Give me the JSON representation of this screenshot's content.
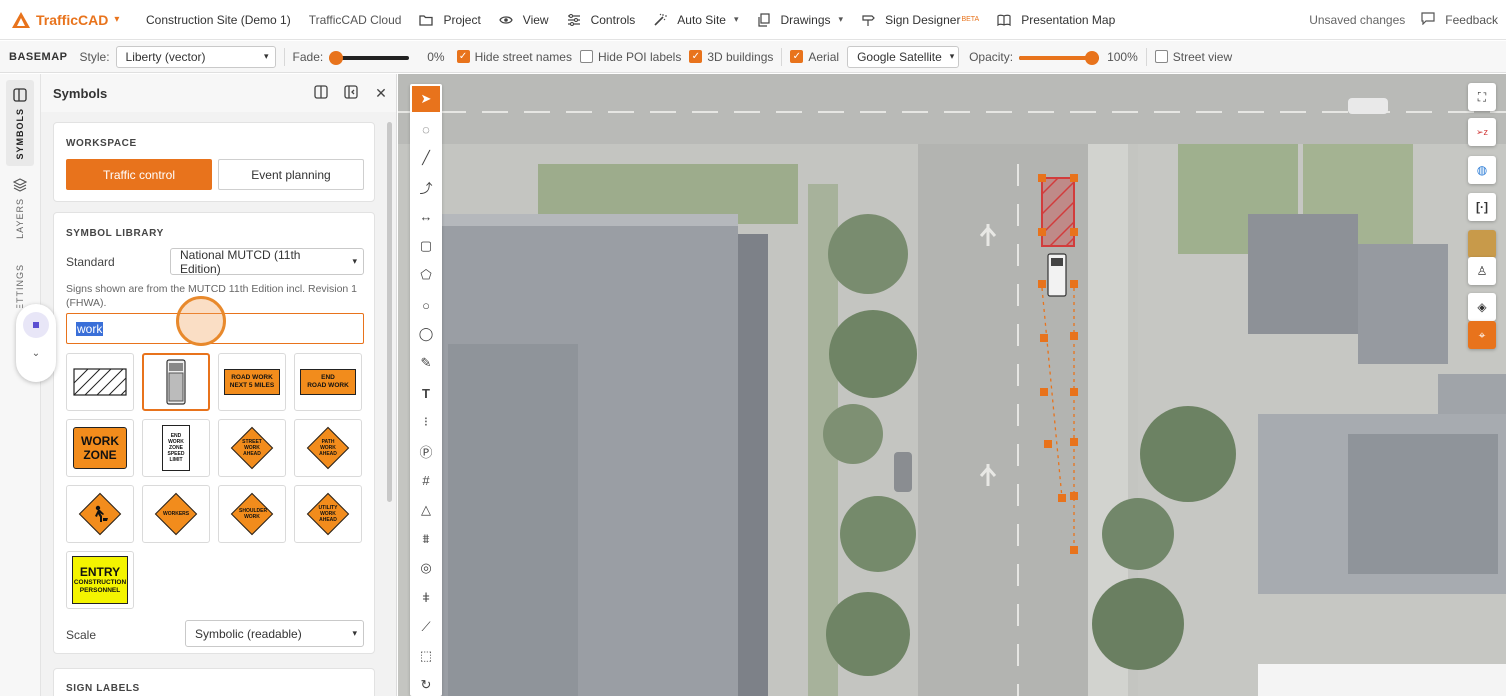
{
  "app": {
    "name": "TrafficCAD",
    "brand_color": "#e8731c"
  },
  "menu": {
    "project_name": "Construction Site (Demo 1)",
    "cloud": "TrafficCAD Cloud",
    "items": [
      {
        "label": "Project",
        "icon": "folder-icon"
      },
      {
        "label": "View",
        "icon": "eye-icon"
      },
      {
        "label": "Controls",
        "icon": "sliders-icon"
      },
      {
        "label": "Auto Site",
        "icon": "magic-wand-icon"
      },
      {
        "label": "Drawings",
        "icon": "drawings-icon"
      },
      {
        "label": "Sign Designer",
        "icon": "sign-icon",
        "badge": "BETA"
      },
      {
        "label": "Presentation Map",
        "icon": "book-icon"
      }
    ],
    "unsaved": "Unsaved changes",
    "feedback": "Feedback"
  },
  "basemap": {
    "label": "BASEMAP",
    "style_label": "Style:",
    "style_value": "Liberty (vector)",
    "fade_label": "Fade:",
    "fade_value": "0%",
    "fade_fraction": 0.0,
    "hide_street_names": {
      "label": "Hide street names",
      "checked": true
    },
    "hide_poi_labels": {
      "label": "Hide POI labels",
      "checked": false
    },
    "buildings_3d": {
      "label": "3D buildings",
      "checked": true
    },
    "aerial": {
      "label": "Aerial",
      "checked": true
    },
    "aerial_source": "Google Satellite",
    "opacity_label": "Opacity:",
    "opacity_value": "100%",
    "opacity_fraction": 1.0,
    "street_view": {
      "label": "Street view",
      "checked": false
    }
  },
  "rail": {
    "tabs": [
      "SYMBOLS",
      "LAYERS",
      "SETTINGS"
    ]
  },
  "panel": {
    "title": "Symbols",
    "workspace": {
      "heading": "WORKSPACE",
      "traffic_control": "Traffic control",
      "event_planning": "Event planning"
    },
    "library": {
      "heading": "SYMBOL LIBRARY",
      "standard_label": "Standard",
      "standard_value": "National MUTCD (11th Edition)",
      "note": "Signs shown are from the MUTCD 11th Edition incl. Revision 1 (FHWA).",
      "search_value": "work",
      "scale_label": "Scale",
      "scale_value": "Symbolic (readable)"
    },
    "signs": {
      "road_work_next": [
        "ROAD WORK",
        "NEXT 5 MILES"
      ],
      "end_road_work": [
        "END",
        "ROAD WORK"
      ],
      "work_zone": [
        "WORK",
        "ZONE"
      ],
      "end_work_zone_speed": [
        "END",
        "WORK",
        "ZONE",
        "SPEED",
        "LIMIT"
      ],
      "street_work_ahead": [
        "STREET",
        "WORK",
        "AHEAD"
      ],
      "path_work_ahead": [
        "PATH",
        "WORK",
        "AHEAD"
      ],
      "workers": "WORKERS",
      "shoulder_work": [
        "SHOULDER",
        "WORK"
      ],
      "utility_work_ahead": [
        "UTILITY",
        "WORK",
        "AHEAD"
      ],
      "entry": [
        "ENTRY",
        "CONSTRUCTION",
        "PERSONNEL"
      ]
    },
    "sign_labels_heading": "SIGN LABELS"
  }
}
